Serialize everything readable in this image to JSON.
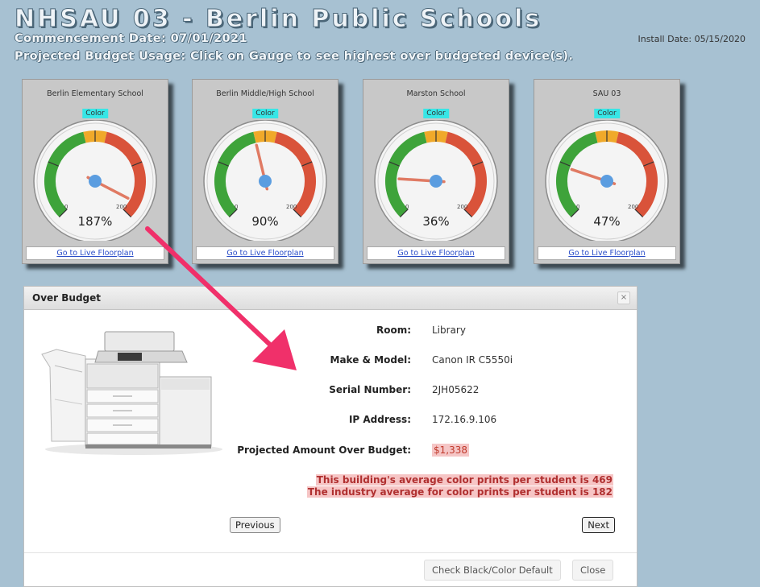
{
  "header": {
    "title": "NHSAU 03 - Berlin Public Schools",
    "commencement": "Commencement Date: 07/01/2021",
    "usage": "Projected Budget Usage: Click on Gauge to see highest over budgeted device(s).",
    "install_date": "Install Date: 05/15/2020"
  },
  "gauges": [
    {
      "name": "Berlin Elementary School",
      "pill": "Color",
      "percent": "187%",
      "value": 187,
      "min_label": "0",
      "max_label": "200",
      "link": "Go to Live Floorplan"
    },
    {
      "name": "Berlin Middle/High School",
      "pill": "Color",
      "percent": "90%",
      "value": 90,
      "min_label": "0",
      "max_label": "200",
      "link": "Go to Live Floorplan"
    },
    {
      "name": "Marston School",
      "pill": "Color",
      "percent": "36%",
      "value": 36,
      "min_label": "0",
      "max_label": "200",
      "link": "Go to Live Floorplan"
    },
    {
      "name": "SAU 03",
      "pill": "Color",
      "percent": "47%",
      "value": 47,
      "min_label": "0",
      "max_label": "200",
      "link": "Go to Live Floorplan"
    }
  ],
  "modal": {
    "title": "Over Budget",
    "close_glyph": "×",
    "fields": [
      {
        "label": "Room:",
        "value": "Library"
      },
      {
        "label": "Make & Model:",
        "value": "Canon IR C5550i"
      },
      {
        "label": "Serial Number:",
        "value": "2JH05622"
      },
      {
        "label": "IP Address:",
        "value": "172.16.9.106"
      },
      {
        "label": "Projected Amount Over Budget:",
        "value": "$1,338"
      }
    ],
    "note_1": "This building's average color prints per student is 469",
    "note_2": "The industry average for color prints per student is 182",
    "previous": "Previous",
    "next": "Next",
    "check_default": "Check Black/Color Default",
    "close": "Close"
  },
  "colors": {
    "gauge_green": "#3ea33a",
    "gauge_yellow": "#f0a92a",
    "gauge_red": "#d9533a",
    "needle": "#e07a63",
    "hub": "#5b9de0",
    "arrow": "#f0306a",
    "pill": "#37e6e6"
  }
}
